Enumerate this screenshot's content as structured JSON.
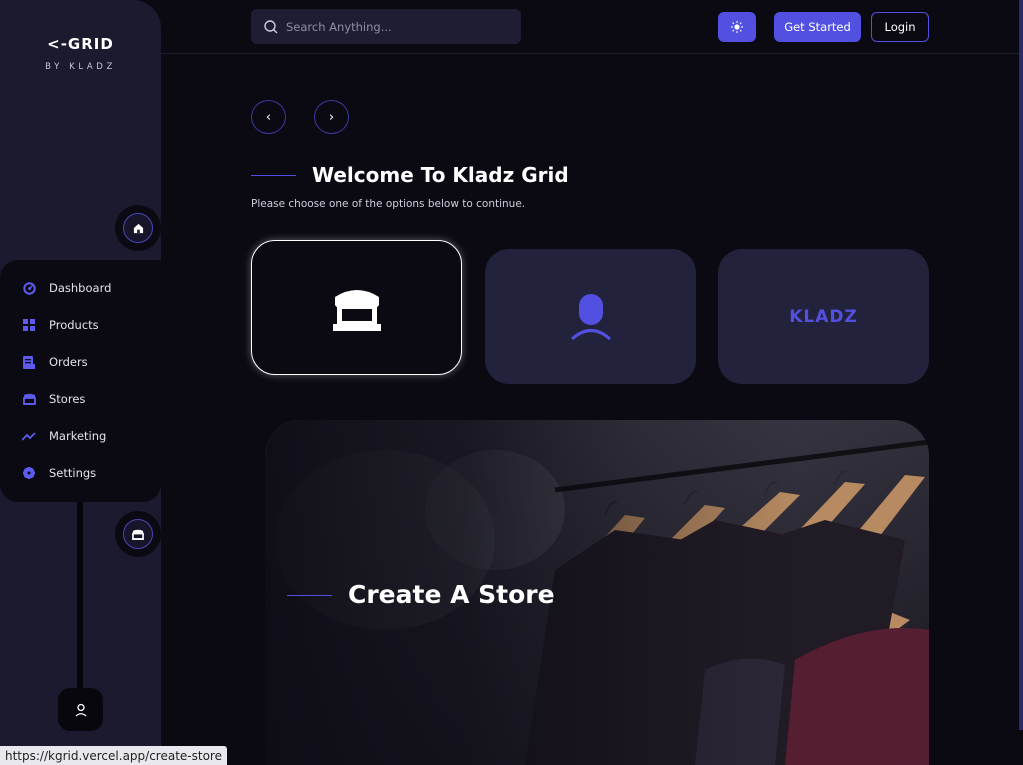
{
  "brand": {
    "logo_text": "<-GRID",
    "subtitle": "BY KLADZ"
  },
  "sidebar": {
    "items": [
      {
        "label": "Dashboard",
        "icon": "dashboard-icon"
      },
      {
        "label": "Products",
        "icon": "grid-icon"
      },
      {
        "label": "Orders",
        "icon": "document-icon"
      },
      {
        "label": "Stores",
        "icon": "store-icon"
      },
      {
        "label": "Marketing",
        "icon": "trend-icon"
      },
      {
        "label": "Settings",
        "icon": "gear-icon"
      }
    ]
  },
  "topbar": {
    "search_placeholder": "Search Anything...",
    "theme_icon": "sun-icon",
    "get_started_label": "Get Started",
    "login_label": "Login"
  },
  "main": {
    "prev_label": "‹",
    "next_label": "›",
    "welcome_title": "Welcome To Kladz Grid",
    "welcome_subtitle": "Please choose one of the options below to continue.",
    "options": [
      {
        "name": "store-option",
        "icon": "store-icon",
        "selected": true
      },
      {
        "name": "user-option",
        "icon": "user-icon",
        "selected": false
      },
      {
        "name": "kladz-option",
        "text": "KLADZ",
        "selected": false
      }
    ],
    "hero_title": "Create A Store"
  },
  "status_url": "https://kgrid.vercel.app/create-store",
  "colors": {
    "accent": "#5250e0",
    "background": "#0b0a13",
    "sidebar": "#1b1a2e",
    "card": "#23223c"
  }
}
